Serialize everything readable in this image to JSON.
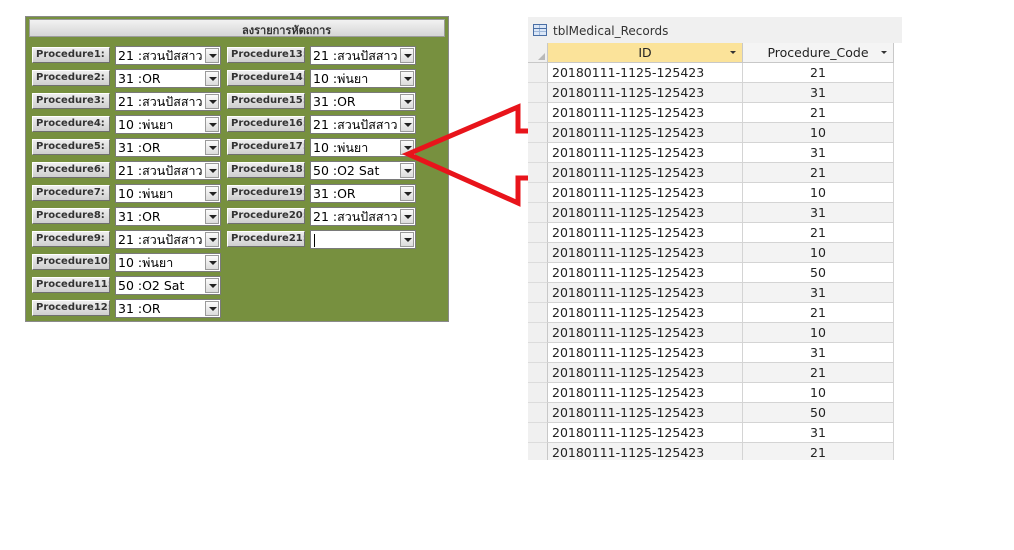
{
  "form": {
    "title": "ลงรายการหัตถการ",
    "procedures": [
      {
        "label": "Procedure1:",
        "value": "21 :สวนปัสสาว"
      },
      {
        "label": "Procedure2:",
        "value": "31 :OR"
      },
      {
        "label": "Procedure3:",
        "value": "21 :สวนปัสสาว"
      },
      {
        "label": "Procedure4:",
        "value": "10 :พ่นยา"
      },
      {
        "label": "Procedure5:",
        "value": "31 :OR"
      },
      {
        "label": "Procedure6:",
        "value": "21 :สวนปัสสาว"
      },
      {
        "label": "Procedure7:",
        "value": "10 :พ่นยา"
      },
      {
        "label": "Procedure8:",
        "value": "31 :OR"
      },
      {
        "label": "Procedure9:",
        "value": "21 :สวนปัสสาว"
      },
      {
        "label": "Procedure10:",
        "value": "10 :พ่นยา"
      },
      {
        "label": "Procedure11:",
        "value": "50 :O2 Sat"
      },
      {
        "label": "Procedure12:",
        "value": "31 :OR"
      },
      {
        "label": "Procedure13:",
        "value": "21 :สวนปัสสาว"
      },
      {
        "label": "Procedure14:",
        "value": "10 :พ่นยา"
      },
      {
        "label": "Procedure15:",
        "value": "31 :OR"
      },
      {
        "label": "Procedure16:",
        "value": "21 :สวนปัสสาว"
      },
      {
        "label": "Procedure17:",
        "value": "10 :พ่นยา"
      },
      {
        "label": "Procedure18:",
        "value": "50 :O2 Sat"
      },
      {
        "label": "Procedure19:",
        "value": "31 :OR"
      },
      {
        "label": "Procedure20:",
        "value": "21 :สวนปัสสาว"
      },
      {
        "label": "Procedure21:",
        "value": ""
      }
    ]
  },
  "datasheet": {
    "title": "tblMedical_Records",
    "columns": [
      "ID",
      "Procedure_Code"
    ],
    "rows": [
      [
        "20180111-1125-125423",
        "21"
      ],
      [
        "20180111-1125-125423",
        "31"
      ],
      [
        "20180111-1125-125423",
        "21"
      ],
      [
        "20180111-1125-125423",
        "10"
      ],
      [
        "20180111-1125-125423",
        "31"
      ],
      [
        "20180111-1125-125423",
        "21"
      ],
      [
        "20180111-1125-125423",
        "10"
      ],
      [
        "20180111-1125-125423",
        "31"
      ],
      [
        "20180111-1125-125423",
        "21"
      ],
      [
        "20180111-1125-125423",
        "10"
      ],
      [
        "20180111-1125-125423",
        "50"
      ],
      [
        "20180111-1125-125423",
        "31"
      ],
      [
        "20180111-1125-125423",
        "21"
      ],
      [
        "20180111-1125-125423",
        "10"
      ],
      [
        "20180111-1125-125423",
        "31"
      ],
      [
        "20180111-1125-125423",
        "21"
      ],
      [
        "20180111-1125-125423",
        "10"
      ],
      [
        "20180111-1125-125423",
        "50"
      ],
      [
        "20180111-1125-125423",
        "31"
      ],
      [
        "20180111-1125-125423",
        "21"
      ]
    ]
  },
  "colors": {
    "form_background": "#77903f",
    "arrow": "#e8141b",
    "active_column_header": "#fbe39a"
  },
  "icons": {
    "combo_dropdown": "chevron-down-icon",
    "table": "table-icon"
  }
}
